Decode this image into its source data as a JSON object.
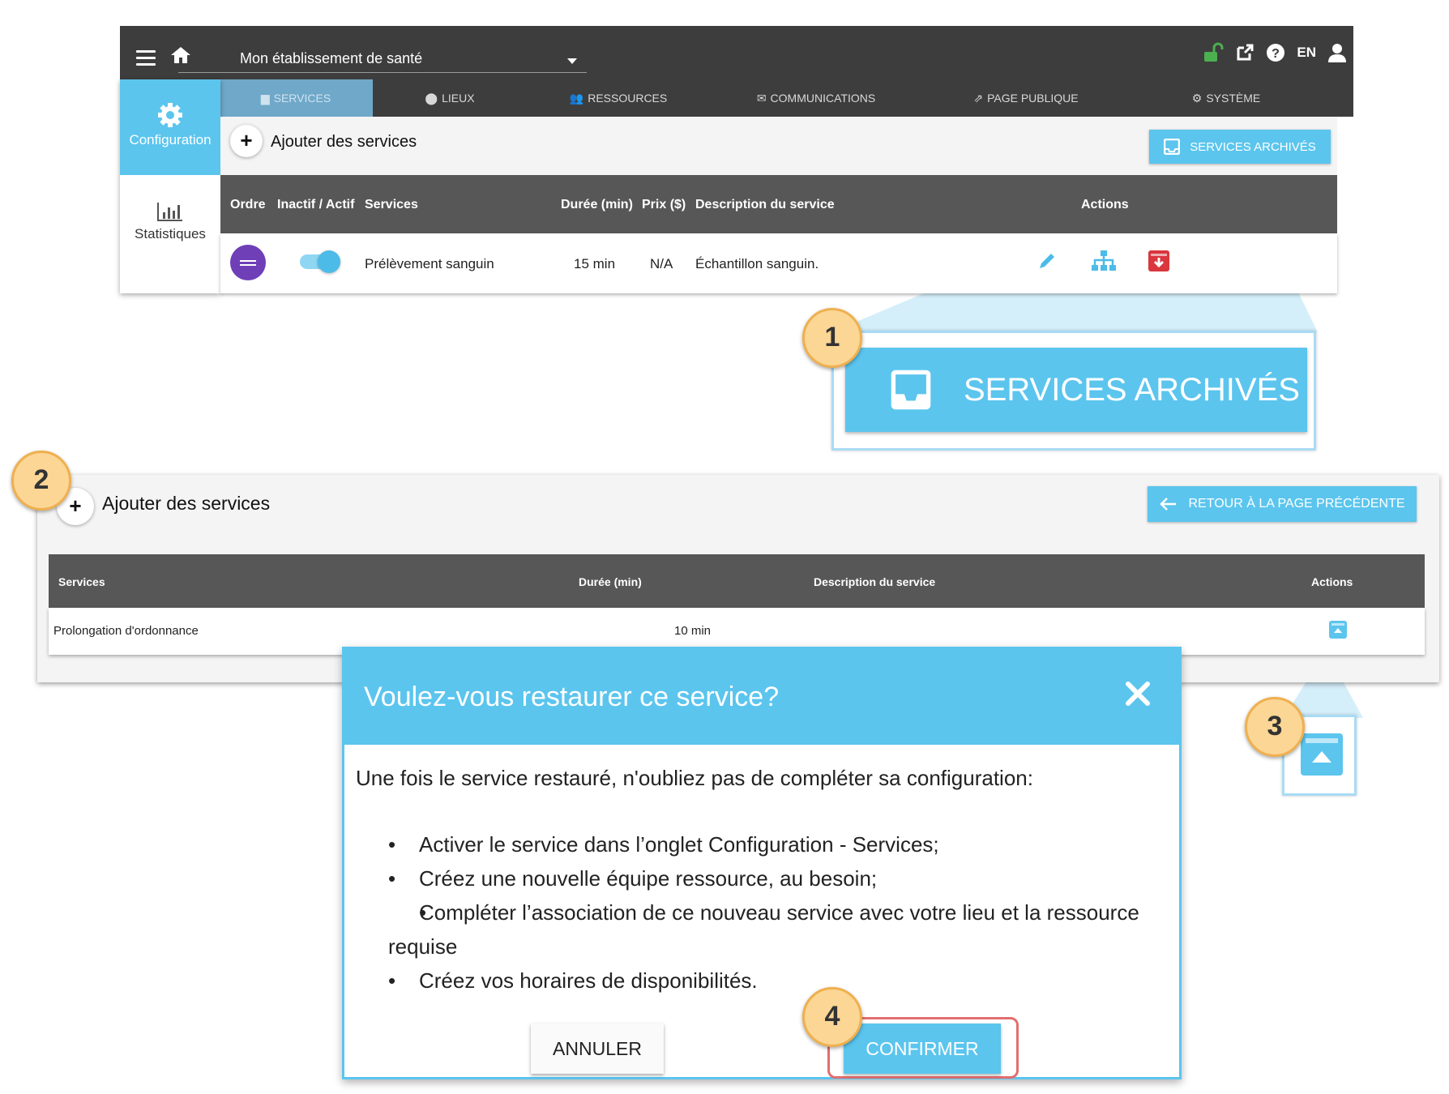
{
  "header": {
    "organization": "Mon établissement de santé",
    "language": "EN"
  },
  "tabs": [
    {
      "label": "SERVICES",
      "icon": "briefcase-icon",
      "active": true
    },
    {
      "label": "LIEUX",
      "icon": "map-pin-icon"
    },
    {
      "label": "RESSOURCES",
      "icon": "users-icon"
    },
    {
      "label": "COMMUNICATIONS",
      "icon": "envelope-icon"
    },
    {
      "label": "PAGE PUBLIQUE",
      "icon": "external-link-icon"
    },
    {
      "label": "SYSTÈME",
      "icon": "gears-icon"
    }
  ],
  "sidebar": {
    "configuration": "Configuration",
    "statistics": "Statistiques"
  },
  "services_page": {
    "add_label": "Ajouter des services",
    "archived_button": "SERVICES ARCHIVÉS",
    "columns": [
      "Ordre",
      "Inactif / Actif",
      "Services",
      "Durée (min)",
      "Prix ($)",
      "Description du service",
      "Actions"
    ],
    "row": {
      "service": "Prélèvement sanguin",
      "duration": "15 min",
      "price": "N/A",
      "description": "Échantillon sanguin.",
      "active": true
    }
  },
  "callouts": {
    "one": "1",
    "two": "2",
    "three": "3",
    "four": "4",
    "zoom_button": "SERVICES ARCHIVÉS"
  },
  "archived_page": {
    "add_label": "Ajouter des services",
    "back_button": "RETOUR À LA PAGE PRÉCÉDENTE",
    "columns": [
      "Services",
      "Durée (min)",
      "Description du service",
      "Actions"
    ],
    "row": {
      "service": "Prolongation d'ordonnance",
      "duration": "10 min"
    }
  },
  "modal": {
    "title": "Voulez-vous restaurer ce service?",
    "intro": "Une fois le service restauré, n'oubliez pas de compléter sa configuration:",
    "items": [
      "Activer le service dans l’onglet Configuration - Services;",
      "Créez une nouvelle équipe ressource, au besoin;",
      "Compléter l’association de ce nouveau service avec votre lieu et la ressource requise",
      "Créez vos horaires de disponibilités."
    ],
    "cancel": "ANNULER",
    "confirm": "CONFIRMER"
  },
  "colors": {
    "accent": "#5bc5ee",
    "header": "#3d3d3d",
    "table_header": "#575757",
    "badge": "#fbd695",
    "order_handle": "#6f3fb8",
    "archive_red": "#d9363e",
    "unlock_green": "#4caf50"
  }
}
